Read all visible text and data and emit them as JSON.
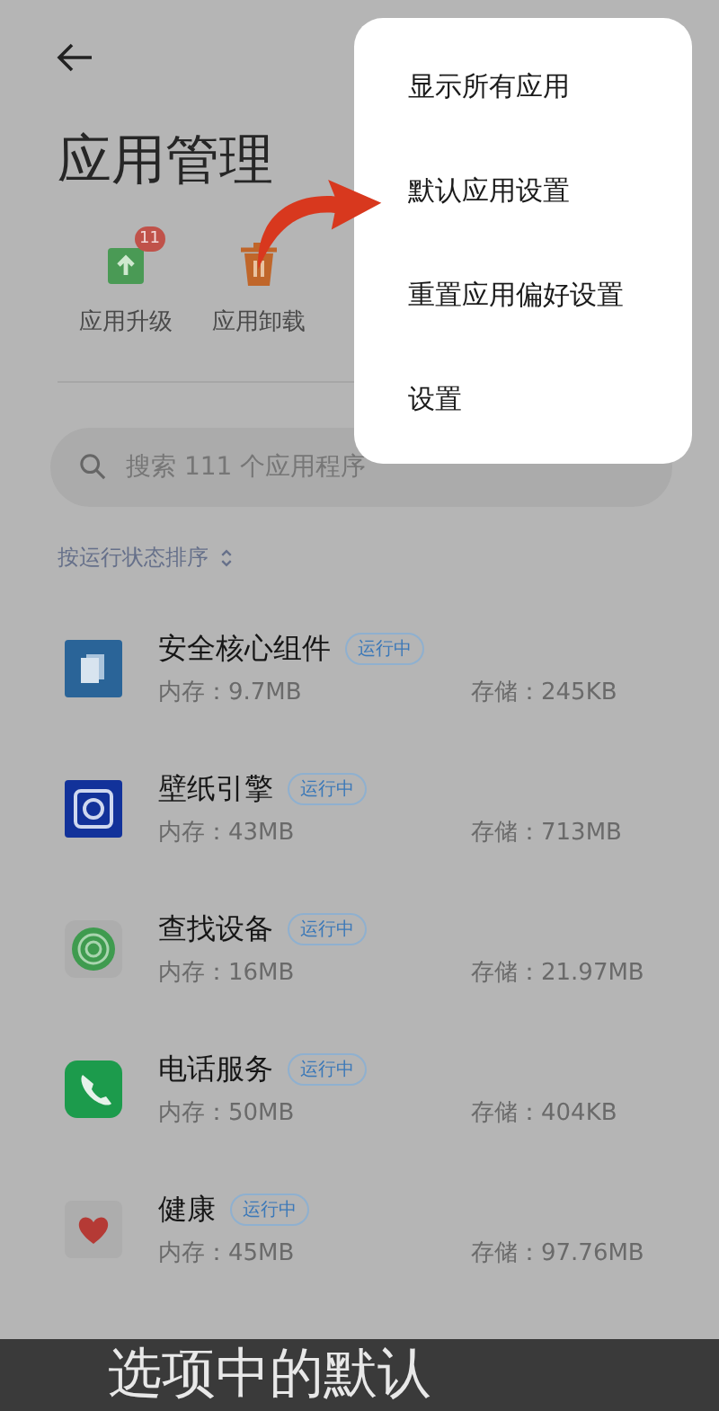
{
  "header": {
    "title": "应用管理"
  },
  "quick_actions": [
    {
      "kind": "upgrade",
      "label": "应用升级",
      "badge": "11"
    },
    {
      "kind": "uninstall",
      "label": "应用卸载"
    }
  ],
  "search": {
    "placeholder": "搜索 111 个应用程序"
  },
  "sort": {
    "label": "按运行状态排序"
  },
  "apps": [
    {
      "kind": "security",
      "name": "安全核心组件",
      "status": "运行中",
      "memory": "内存：9.7MB",
      "storage": "存储：245KB"
    },
    {
      "kind": "wallpaper",
      "name": "壁纸引擎",
      "status": "运行中",
      "memory": "内存：43MB",
      "storage": "存储：713MB"
    },
    {
      "kind": "finder",
      "name": "查找设备",
      "status": "运行中",
      "memory": "内存：16MB",
      "storage": "存储：21.97MB"
    },
    {
      "kind": "phone",
      "name": "电话服务",
      "status": "运行中",
      "memory": "内存：50MB",
      "storage": "存储：404KB"
    },
    {
      "kind": "health",
      "name": "健康",
      "status": "运行中",
      "memory": "内存：45MB",
      "storage": "存储：97.76MB"
    }
  ],
  "menu": {
    "items": [
      "显示所有应用",
      "默认应用设置",
      "重置应用偏好设置",
      "设置"
    ]
  },
  "caption": {
    "text": "选项中的默认"
  }
}
